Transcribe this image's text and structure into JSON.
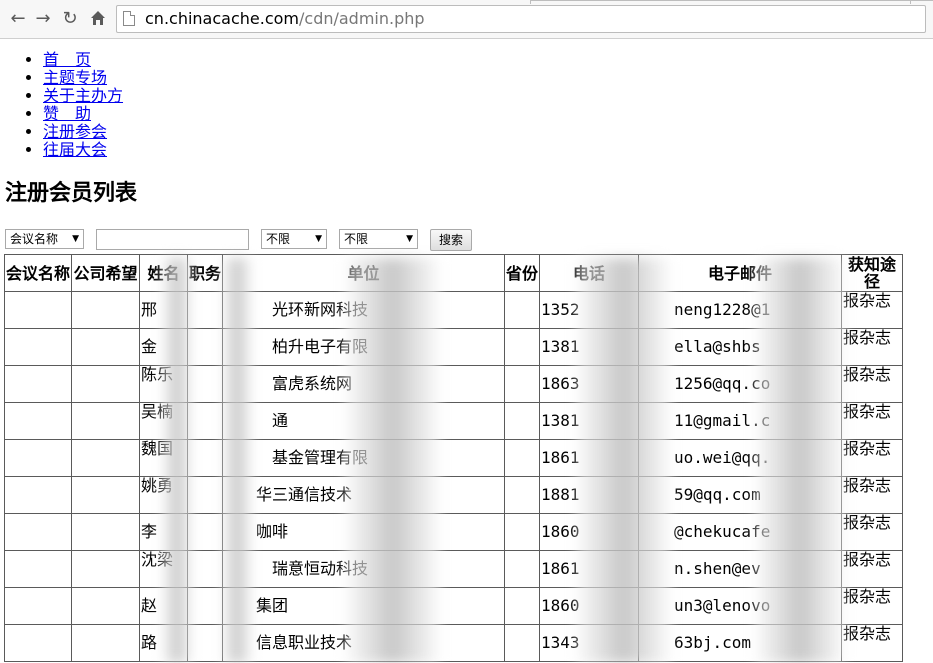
{
  "browser": {
    "back_icon": "arrow-left-icon",
    "forward_icon": "arrow-right-icon",
    "reload_icon": "reload-icon",
    "home_icon": "home-icon",
    "url_host": "cn.chinacache.com",
    "url_path": "/cdn/admin.php"
  },
  "nav": [
    {
      "label": "首　页"
    },
    {
      "label": "主题专场"
    },
    {
      "label": "关于主办方"
    },
    {
      "label": "赞　助"
    },
    {
      "label": "注册参会"
    },
    {
      "label": "往届大会"
    }
  ],
  "page_title": "注册会员列表",
  "filters": {
    "conference_select": "会议名称",
    "search_value": "",
    "select2": "不限",
    "select3": "不限",
    "search_button": "搜索"
  },
  "table": {
    "headers": [
      "会议名称",
      "公司希望",
      "姓名",
      "职务",
      "单位",
      "省份",
      "电话",
      "电子邮件",
      "获知途径"
    ],
    "rows": [
      {
        "name": "邢",
        "company": "光环新网科技",
        "phone": "1352",
        "email": "neng1228@1",
        "source": "报杂志"
      },
      {
        "name": "金",
        "company": "柏升电子有限",
        "phone": "1381",
        "email": "ella@shbs",
        "source": "报杂志"
      },
      {
        "name": "陈乐",
        "company": "富虎系统网",
        "phone": "1863",
        "email": "1256@qq.co",
        "source": "报杂志"
      },
      {
        "name": "吴楠",
        "company": "通",
        "phone": "1381",
        "email": "11@gmail.c",
        "source": "报杂志"
      },
      {
        "name": "魏国",
        "company": "基金管理有限",
        "phone": "1861",
        "email": "uo.wei@qq.",
        "source": "报杂志"
      },
      {
        "name": "姚勇",
        "company": "华三通信技术",
        "phone": "1881",
        "email": "59@qq.com",
        "source": "报杂志"
      },
      {
        "name": "李",
        "company": "咖啡",
        "phone": "1860",
        "email": "@chekucafe",
        "source": "报杂志"
      },
      {
        "name": "沈梁",
        "company": "瑞意恒动科技",
        "phone": "1861",
        "email": "n.shen@ev",
        "source": "报杂志"
      },
      {
        "name": "赵",
        "company": "集团",
        "phone": "1860",
        "email": "un3@lenovo",
        "source": "报杂志"
      },
      {
        "name": "路",
        "company": "信息职业技术",
        "phone": "1343",
        "email": "63bj.com",
        "source": "报杂志"
      }
    ]
  }
}
